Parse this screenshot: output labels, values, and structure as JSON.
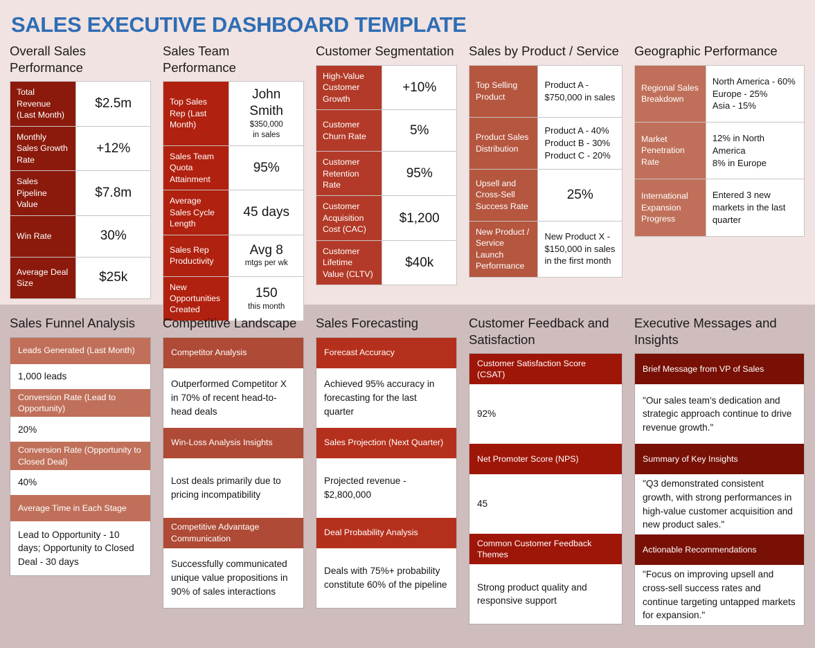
{
  "title": "SALES EXECUTIVE DASHBOARD TEMPLATE",
  "colors": {
    "title_blue": "#2E6DB4",
    "top_bg": "#F1E3E1",
    "bottom_bg": "#CFBDBD",
    "accent_1": "#8B1A0C",
    "accent_2": "#B0210F",
    "accent_3": "#B33A28",
    "accent_4": "#B5563F",
    "accent_5": "#C0705A"
  },
  "top": {
    "columns": [
      {
        "heading": "Overall Sales Performance",
        "rows": [
          {
            "key": "Total Revenue (Last Month)",
            "value": "$2.5m"
          },
          {
            "key": "Monthly Sales Growth Rate",
            "value": "+12%"
          },
          {
            "key": "Sales Pipeline Value",
            "value": "$7.8m"
          },
          {
            "key": "Win Rate",
            "value": "30%"
          },
          {
            "key": "Average Deal Size",
            "value": "$25k"
          }
        ]
      },
      {
        "heading": "Sales Team Performance",
        "rows": [
          {
            "key": "Top Sales Rep (Last Month)",
            "value": "John Smith",
            "sub": "$350,000\nin sales"
          },
          {
            "key": "Sales Team Quota Attainment",
            "value": "95%"
          },
          {
            "key": "Average Sales Cycle Length",
            "value": "45 days"
          },
          {
            "key": "Sales Rep Productivity",
            "value": "Avg 8",
            "sub": "mtgs per wk"
          },
          {
            "key": "New Opportunities Created",
            "value": "150",
            "sub": "this month"
          }
        ]
      },
      {
        "heading": "Customer Segmentation",
        "rows": [
          {
            "key": "High-Value Customer Growth",
            "value": "+10%"
          },
          {
            "key": "Customer Churn Rate",
            "value": "5%"
          },
          {
            "key": "Customer Retention Rate",
            "value": "95%"
          },
          {
            "key": "Customer Acquisition Cost (CAC)",
            "value": "$1,200"
          },
          {
            "key": "Customer Lifetime Value (CLTV)",
            "value": "$40k"
          }
        ]
      },
      {
        "heading": "Sales by Product / Service",
        "rows": [
          {
            "key": "Top Selling Product",
            "value": "Product A - $750,000 in sales",
            "style": "small"
          },
          {
            "key": "Product Sales Distribution",
            "value": "Product A - 40%\nProduct B - 30%\nProduct C - 20%",
            "style": "small"
          },
          {
            "key": "Upsell and Cross-Sell Success Rate",
            "value": "25%"
          },
          {
            "key": "New Product / Service Launch Performance",
            "value": "New Product X - $150,000 in sales in the first month",
            "style": "small"
          }
        ]
      },
      {
        "heading": "Geographic Performance",
        "rows": [
          {
            "key": "Regional Sales Breakdown",
            "value": "North America - 60%\nEurope - 25%\nAsia - 15%",
            "style": "small"
          },
          {
            "key": "Market Penetration Rate",
            "value": "12% in North America\n8% in Europe",
            "style": "small"
          },
          {
            "key": "International Expansion Progress",
            "value": "Entered 3 new markets in the last quarter",
            "style": "small"
          }
        ]
      }
    ]
  },
  "bottom": {
    "columns": [
      {
        "heading": "Sales Funnel Analysis",
        "panels": [
          {
            "header": "Leads Generated (Last Month)",
            "body": "1,000 leads"
          },
          {
            "header": "Conversion Rate (Lead to Opportunity)",
            "body": "20%"
          },
          {
            "header": "Conversion Rate (Opportunity to Closed Deal)",
            "body": "40%"
          },
          {
            "header": "Average Time in Each Stage",
            "body": "Lead to Opportunity - 10 days; Opportunity to Closed Deal - 30 days"
          }
        ]
      },
      {
        "heading": "Competitive Landscape",
        "panels": [
          {
            "header": "Competitor Analysis",
            "body": "Outperformed Competitor X in 70% of recent head-to-head deals"
          },
          {
            "header": "Win-Loss Analysis Insights",
            "body": "Lost deals primarily due to pricing incompatibility"
          },
          {
            "header": "Competitive Advantage Communication",
            "body": "Successfully communicated unique value propositions in 90% of sales interactions"
          }
        ]
      },
      {
        "heading": "Sales Forecasting",
        "panels": [
          {
            "header": "Forecast Accuracy",
            "body": "Achieved 95% accuracy in forecasting for the last quarter"
          },
          {
            "header": "Sales Projection (Next Quarter)",
            "body": "Projected revenue - $2,800,000"
          },
          {
            "header": "Deal Probability Analysis",
            "body": "Deals with 75%+ probability constitute 60% of the pipeline"
          }
        ]
      },
      {
        "heading": "Customer Feedback and Satisfaction",
        "panels": [
          {
            "header": "Customer Satisfaction Score (CSAT)",
            "body": "92%"
          },
          {
            "header": "Net Promoter Score (NPS)",
            "body": "45"
          },
          {
            "header": "Common Customer Feedback Themes",
            "body": "Strong product quality and responsive support"
          }
        ]
      },
      {
        "heading": "Executive Messages and Insights",
        "panels": [
          {
            "header": "Brief Message from VP of Sales",
            "body": "\"Our sales team's dedication and strategic approach continue to drive revenue growth.\""
          },
          {
            "header": "Summary of Key Insights",
            "body": "\"Q3 demonstrated consistent growth, with strong performances in high-value customer acquisition and new product sales.\""
          },
          {
            "header": "Actionable Recommendations",
            "body": "\"Focus on improving upsell and cross-sell success rates and continue targeting untapped markets for expansion.\""
          }
        ]
      }
    ]
  }
}
